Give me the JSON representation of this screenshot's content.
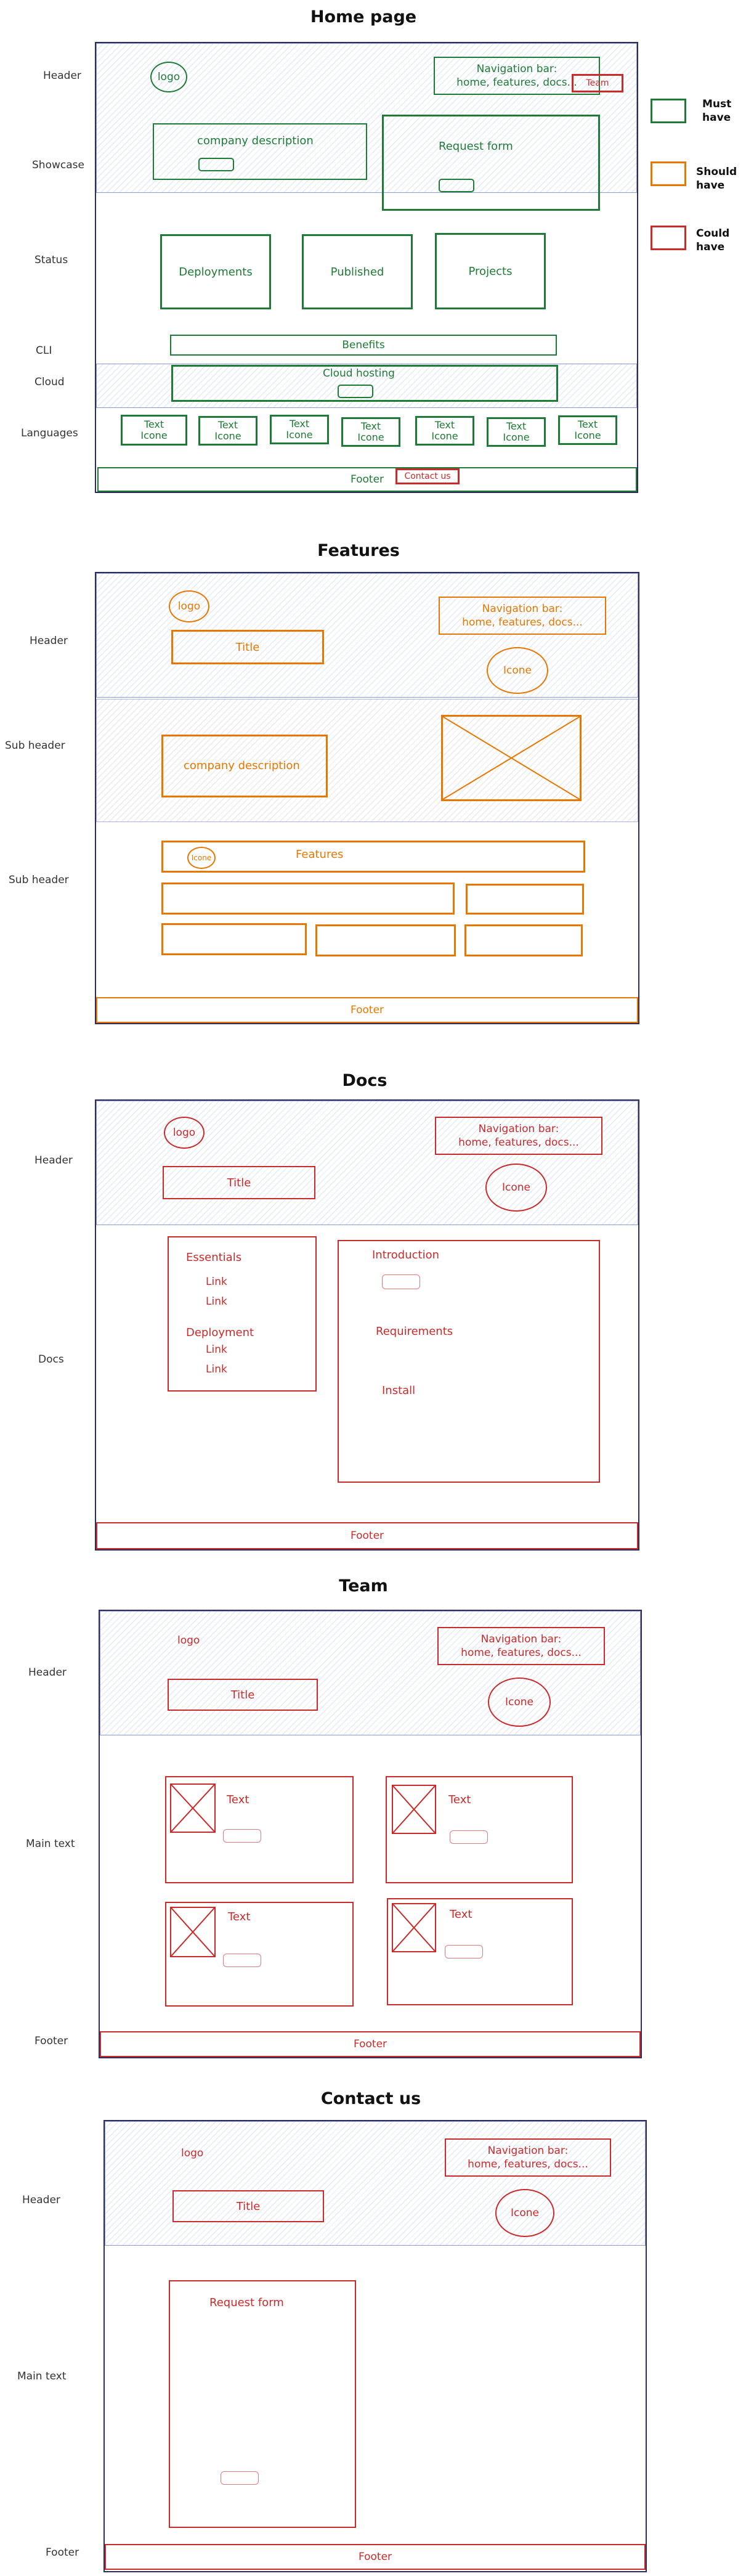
{
  "legend": {
    "must": "Must have",
    "should": "Should have",
    "could": "Could have",
    "colors": {
      "must": "#1e7b36",
      "should": "#e67700",
      "could": "#c92a2a"
    }
  },
  "home": {
    "title": "Home page",
    "side": {
      "header": "Header",
      "showcase": "Showcase",
      "status": "Status",
      "cli": "CLI",
      "cloud": "Cloud",
      "languages": "Languages"
    },
    "logo": "logo",
    "nav": "Navigation bar:\nhome, features, docs...",
    "team": "Team",
    "company": "company description",
    "request": "Request form",
    "deployments": "Deployments",
    "published": "Published",
    "projects": "Projects",
    "benefits": "Benefits",
    "cloud_hosting": "Cloud hosting",
    "lang_items": [
      "Text\nIcone",
      "Text\nIcone",
      "Text\nIcone",
      "Text\nIcone",
      "Text\nIcone",
      "Text\nIcone",
      "Text\nIcone"
    ],
    "footer": "Footer",
    "contact": "Contact us"
  },
  "features": {
    "title": "Features",
    "side": {
      "header": "Header",
      "sub1": "Sub header",
      "sub2": "Sub header"
    },
    "logo": "logo",
    "nav": "Navigation bar:\nhome, features, docs...",
    "page_title": "Title",
    "icone": "Icone",
    "company": "company description",
    "features_bar": "Features",
    "small_icone": "Icone",
    "footer": "Footer"
  },
  "docs": {
    "title": "Docs",
    "side": {
      "header": "Header",
      "docs": "Docs"
    },
    "logo": "logo",
    "nav": "Navigation bar:\nhome, features, docs...",
    "page_title": "Title",
    "icone": "Icone",
    "essentials": "Essentials",
    "link1": "Link",
    "link2": "Link",
    "deployment": "Deployment",
    "link3": "Link",
    "link4": "Link",
    "introduction": "Introduction",
    "requirements": "Requirements",
    "install": "Install",
    "footer": "Footer"
  },
  "team": {
    "title": "Team",
    "side": {
      "header": "Header",
      "main": "Main text",
      "footer": "Footer"
    },
    "logo": "logo",
    "nav": "Navigation bar:\nhome, features, docs...",
    "page_title": "Title",
    "icone": "Icone",
    "cards": [
      "Text",
      "Text",
      "Text",
      "Text"
    ],
    "footer": "Footer"
  },
  "contact": {
    "title": "Contact us",
    "side": {
      "header": "Header",
      "main": "Main text",
      "footer": "Footer"
    },
    "logo": "logo",
    "nav": "Navigation bar:\nhome, features, docs...",
    "page_title": "Title",
    "icone": "Icone",
    "request": "Request form",
    "footer": "Footer"
  }
}
